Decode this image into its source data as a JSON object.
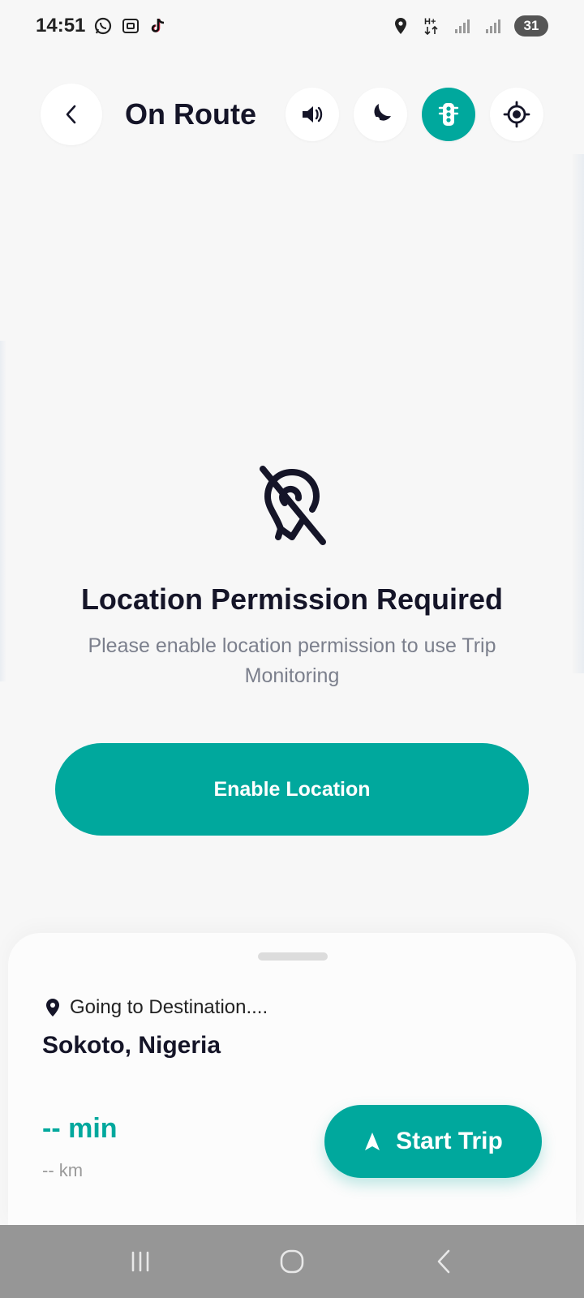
{
  "status_bar": {
    "time": "14:51",
    "battery": "31",
    "icons": [
      "whatsapp-icon",
      "gallery-icon",
      "tiktok-icon",
      "location-icon",
      "hplus-data-icon",
      "signal-icon",
      "signal-icon"
    ]
  },
  "header": {
    "title": "On Route",
    "buttons": [
      "back-icon",
      "volume-icon",
      "night-mode-icon",
      "traffic-light-icon",
      "recenter-icon"
    ]
  },
  "permission": {
    "icon": "location-off-icon",
    "title": "Location Permission Required",
    "description": "Please enable location permission to use Trip Monitoring",
    "button_label": "Enable Location"
  },
  "sheet": {
    "destination_label": "Going to Destination....",
    "destination_name": "Sokoto, Nigeria",
    "eta": "-- min",
    "distance": "-- km",
    "start_label": "Start Trip"
  },
  "colors": {
    "accent": "#00a89d",
    "text_dark": "#151528",
    "text_muted": "#7b7f8c"
  }
}
